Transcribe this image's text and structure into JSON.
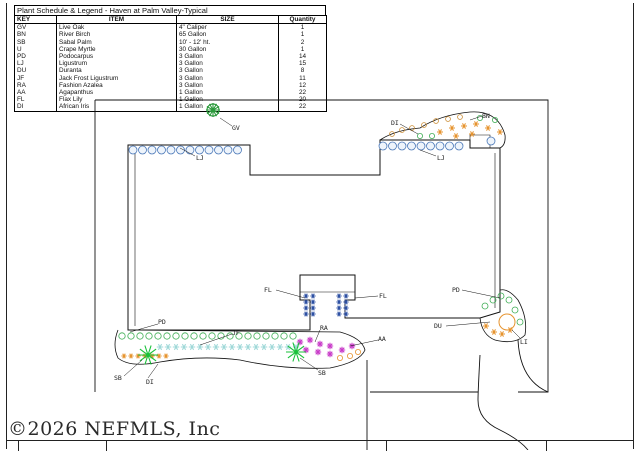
{
  "schedule": {
    "title": "Plant Schedule & Legend - Haven at Palm Valley-Typical",
    "headers": {
      "key": "KEY",
      "item": "ITEM",
      "size": "SIZE",
      "quantity": "Quantity"
    },
    "rows": [
      {
        "key": "GV",
        "item": "Live Oak",
        "size": "4\" Caliper",
        "quantity": "1"
      },
      {
        "key": "BN",
        "item": "River Birch",
        "size": "65 Gallon",
        "quantity": "1"
      },
      {
        "key": "SB",
        "item": "Sabal Palm",
        "size": "10' - 12' ht.",
        "quantity": "2"
      },
      {
        "key": "U",
        "item": "Crape Myrtle",
        "size": "30 Gallon",
        "quantity": "1"
      },
      {
        "key": "PD",
        "item": "Podocarpus",
        "size": "3 Gallon",
        "quantity": "14"
      },
      {
        "key": "LJ",
        "item": "Ligustrum",
        "size": "3 Gallon",
        "quantity": "15"
      },
      {
        "key": "DU",
        "item": "Duranta",
        "size": "3 Gallon",
        "quantity": "8"
      },
      {
        "key": "JF",
        "item": "Jack Frost Ligustrum",
        "size": "3 Gallon",
        "quantity": "11"
      },
      {
        "key": "RA",
        "item": "Fashion Azalea",
        "size": "3 Gallon",
        "quantity": "12"
      },
      {
        "key": "AA",
        "item": "Agapanthus",
        "size": "1 Gallon",
        "quantity": "22"
      },
      {
        "key": "FL",
        "item": "Flax Lily",
        "size": "1 Gallon",
        "quantity": "20"
      },
      {
        "key": "DI",
        "item": "African Iris",
        "size": "1 Gallon",
        "quantity": "22"
      }
    ]
  },
  "plan": {
    "labels": {
      "gv": "GV",
      "bn": "BN",
      "di_top": "DI",
      "lj_left": "LJ",
      "lj_right": "LJ",
      "fl_left": "FL",
      "fl_right": "FL",
      "pd_right": "PD",
      "du": "DU",
      "li": "LI",
      "pd_left": "PD",
      "jf": "JF",
      "ra": "RA",
      "aa": "AA",
      "sb_left": "SB",
      "di_bottom": "DI",
      "sb_right": "SB"
    },
    "colors": {
      "outline": "#111111",
      "lj_shrub": "#4a78b8",
      "fl_lily": "#2c4fa3",
      "jf_shrub": "#9fd8d8",
      "green_shrub": "#3fae55",
      "palm": "#19c23a",
      "azalea": "#c83bc8",
      "orange_bed": "#e6932e",
      "iris": "#c98a30",
      "gv_tree": "#2c9a3c"
    }
  },
  "watermark": "©2026 NEFMLS, Inc"
}
